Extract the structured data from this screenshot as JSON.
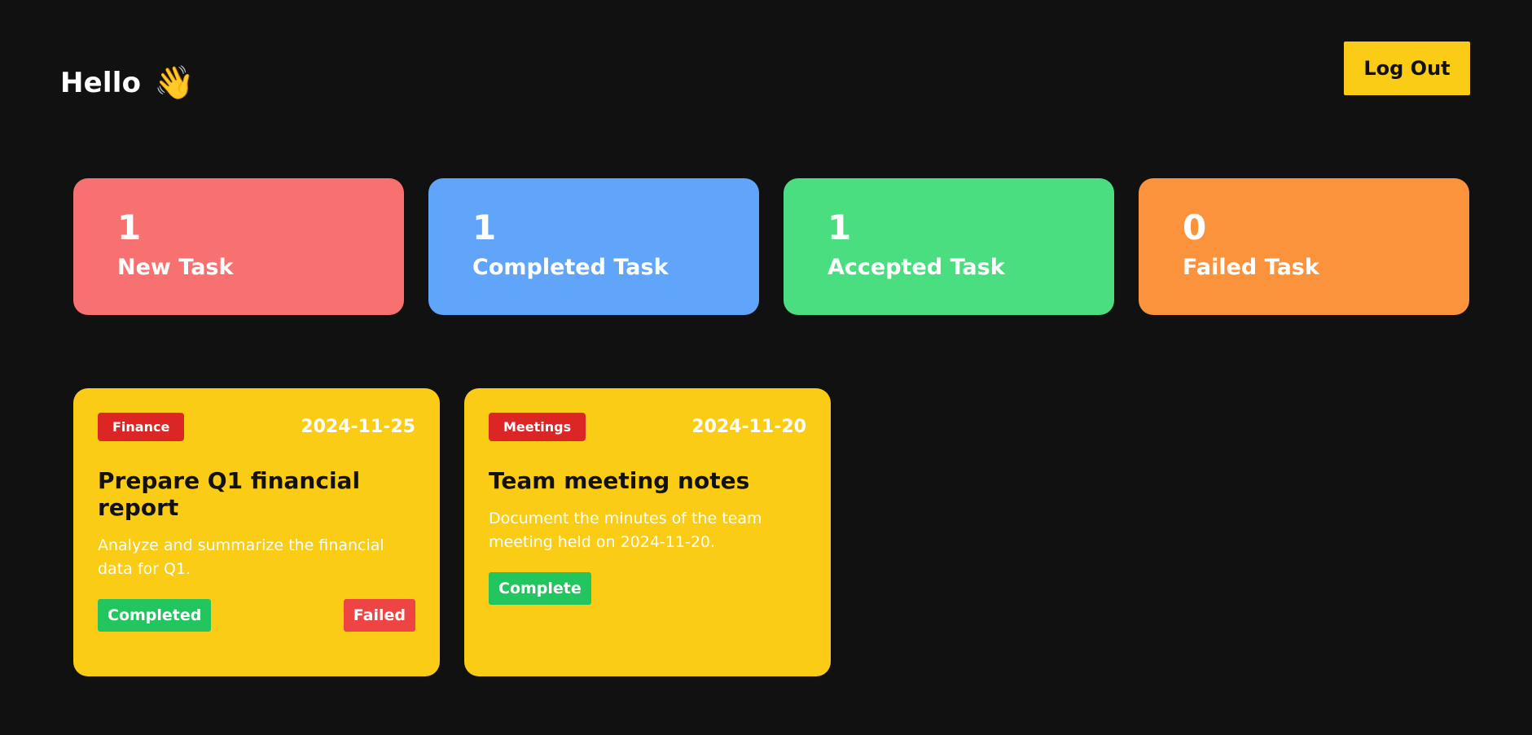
{
  "header": {
    "greeting": "Hello",
    "wave_emoji": "👋",
    "logout_label": "Log Out"
  },
  "stats": [
    {
      "count": "1",
      "label": "New Task",
      "color": "#f87171"
    },
    {
      "count": "1",
      "label": "Completed Task",
      "color": "#60a5fa"
    },
    {
      "count": "1",
      "label": "Accepted Task",
      "color": "#4ade80"
    },
    {
      "count": "0",
      "label": "Failed Task",
      "color": "#fb923c"
    }
  ],
  "tasks": [
    {
      "category": "Finance",
      "date": "2024-11-25",
      "title": "Prepare Q1 financial report",
      "description": "Analyze and summarize the financial data for Q1.",
      "actions": [
        "Completed",
        "Failed"
      ]
    },
    {
      "category": "Meetings",
      "date": "2024-11-20",
      "title": "Team meeting notes",
      "description": "Document the minutes of the team meeting held on 2024-11-20.",
      "actions": [
        "Complete"
      ]
    }
  ],
  "colors": {
    "background": "#111111",
    "accent": "#facc15",
    "category_badge": "#dc2626",
    "success": "#22c55e",
    "danger": "#ef4444"
  }
}
